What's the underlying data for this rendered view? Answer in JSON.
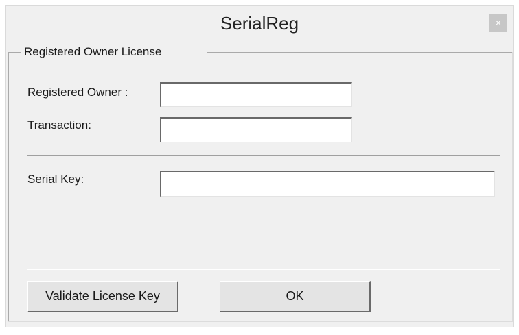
{
  "window": {
    "title": "SerialReg",
    "close_glyph": "×"
  },
  "group": {
    "title": "Registered Owner License"
  },
  "fields": {
    "owner_label": "Registered Owner :",
    "owner_value": "",
    "transaction_label": "Transaction:",
    "transaction_value": "",
    "serial_label": "Serial Key:",
    "serial_value": ""
  },
  "buttons": {
    "validate_label": "Validate License Key",
    "ok_label": "OK"
  }
}
